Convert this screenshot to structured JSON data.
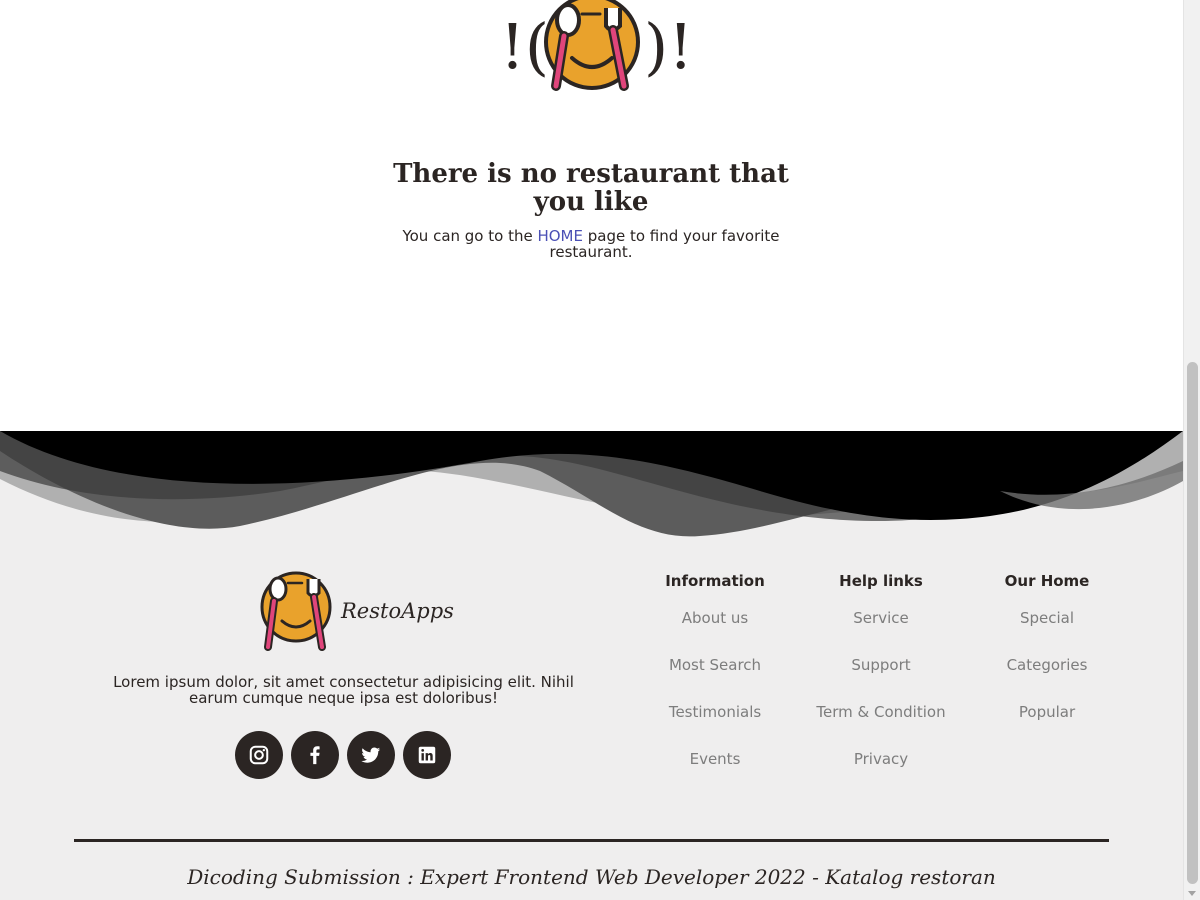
{
  "empty_state": {
    "title": "There is no restaurant that you like",
    "desc_before": "You can go to the ",
    "home_link": "HOME",
    "desc_after": " page to find your favorite restaurant."
  },
  "footer": {
    "brand_name": "RestoApps",
    "about_text": "Lorem ipsum dolor, sit amet consectetur adipisicing elit. Nihil earum cumque neque ipsa est doloribus!",
    "socials": [
      "instagram-icon",
      "facebook-icon",
      "twitter-icon",
      "linkedin-icon"
    ],
    "columns": [
      {
        "title": "Information",
        "items": [
          "About us",
          "Most Search",
          "Testimonials",
          "Events"
        ]
      },
      {
        "title": "Help links",
        "items": [
          "Service",
          "Support",
          "Term & Condition",
          "Privacy"
        ]
      },
      {
        "title": "Our Home",
        "items": [
          "Special",
          "Categories",
          "Popular"
        ]
      }
    ],
    "credit": "Dicoding Submission : Expert Frontend Web Developer 2022 - Katalog restoran"
  },
  "colors": {
    "text": "#2b2523",
    "link": "#4b50b5",
    "footer_bg": "#efeeee",
    "muted": "#7d7d7d",
    "logo_orange": "#e9a22c",
    "utensil_pink": "#e0457b"
  }
}
